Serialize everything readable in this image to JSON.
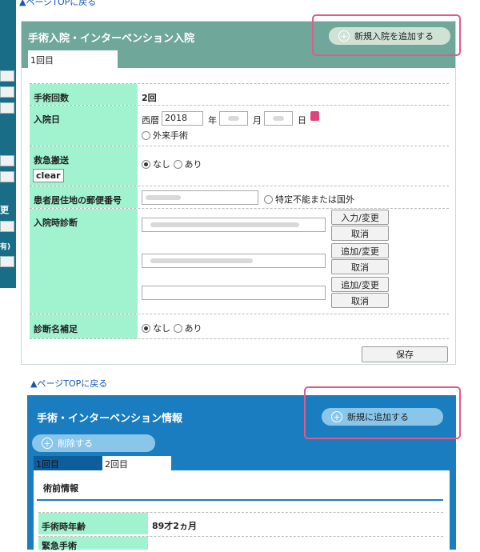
{
  "top_link": "▲ページTOPに戻る",
  "sidebar": {
    "chars": [
      "更",
      "有)"
    ]
  },
  "admission": {
    "title": "手術入院・インターベンション入院",
    "add_button": "新規入院を追加する",
    "tab": "1回目",
    "rows": {
      "surgery_count": {
        "label": "手術回数",
        "value": "2回"
      },
      "admission_date": {
        "label": "入院日",
        "era_label": "西暦",
        "year_value": "2018",
        "year_unit": "年",
        "month_unit": "月",
        "day_unit": "日",
        "outpatient": "外来手術"
      },
      "emergency": {
        "label": "救急搬送",
        "clear": "clear",
        "none": "なし",
        "yes": "あり"
      },
      "postal": {
        "label": "患者居住地の郵便番号",
        "unknown": "特定不能または国外"
      },
      "diagnosis": {
        "label": "入院時診断",
        "btn_input_change": "入力/変更",
        "btn_cancel": "取消",
        "btn_add_change": "追加/変更"
      },
      "supplement": {
        "label": "診断名補足",
        "none": "なし",
        "yes": "あり"
      }
    },
    "save_button": "保存"
  },
  "surgery": {
    "top_link": "▲ページTOPに戻る",
    "title": "手術・インターベンション情報",
    "add_button": "新規に追加する",
    "delete_button": "削除する",
    "tabs": [
      "1回目",
      "2回目"
    ],
    "section": "術前情報",
    "rows": {
      "age": {
        "label": "手術時年齢",
        "value": "89才2ヵ月"
      },
      "emergency": {
        "label": "緊急手術"
      }
    }
  },
  "colors": {
    "panel_header": "#6fa89b",
    "label_bg": "#a1f3d0",
    "panel2": "#1a7dbf",
    "highlight": "#e05a8a"
  }
}
